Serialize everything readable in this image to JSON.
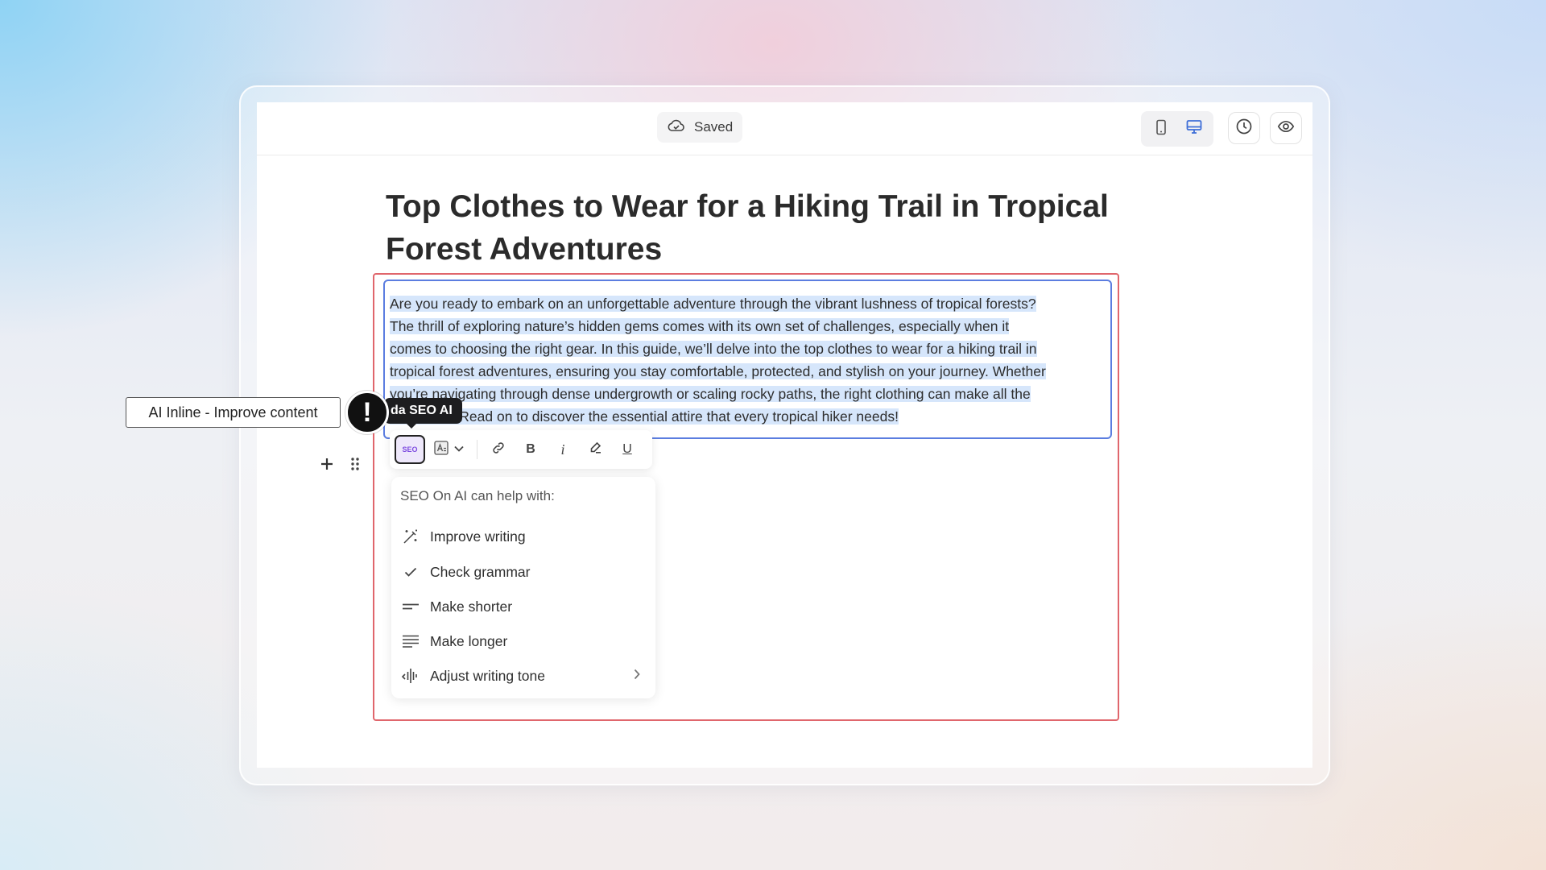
{
  "topbar": {
    "saved_label": "Saved",
    "icons": [
      "cloud-check-icon",
      "mobile-device-icon",
      "desktop-device-icon",
      "history-clock-icon",
      "preview-eye-icon"
    ]
  },
  "article": {
    "title": "Top Clothes to Wear for a Hiking Trail in Tropical Forest Adventures",
    "paragraph_lines": [
      "Are you ready to embark on an unforgettable adventure through the vibrant lushness of tropical forests?",
      "The thrill of exploring nature’s hidden gems comes with its own set of challenges, especially when it",
      "comes to choosing the right gear. In this guide, we’ll delve into the top clothes to wear for a hiking trail in",
      "tropical forest adventures, ensuring you stay comfortable, protected, and stylish on your journey. Whether",
      "you’re navigating through dense undergrowth or scaling rocky paths, the right clothing can make all the",
      "difference. Read on to discover the essential attire that every tropical hiker needs!"
    ]
  },
  "tooltip": {
    "seo_label": "da SEO AI"
  },
  "annotation": {
    "label": "AI Inline - Improve content",
    "badge": "!"
  },
  "toolbar": {
    "seo_button_label": "SEO",
    "bold": "B",
    "italic": "i",
    "underline": "U"
  },
  "ai_menu": {
    "header": "SEO On AI can help with:",
    "items": [
      {
        "label": "Improve writing",
        "icon": "magic-wand-icon"
      },
      {
        "label": "Check grammar",
        "icon": "check-icon"
      },
      {
        "label": "Make shorter",
        "icon": "short-lines-icon"
      },
      {
        "label": "Make longer",
        "icon": "long-lines-icon"
      },
      {
        "label": "Adjust writing tone",
        "icon": "sound-wave-icon"
      }
    ]
  },
  "colors": {
    "selection_highlight": "#d6e6fb",
    "focus_border": "#5b7de0",
    "annotation_frame": "#e0666c",
    "accent_device": "#3f6fd8"
  }
}
